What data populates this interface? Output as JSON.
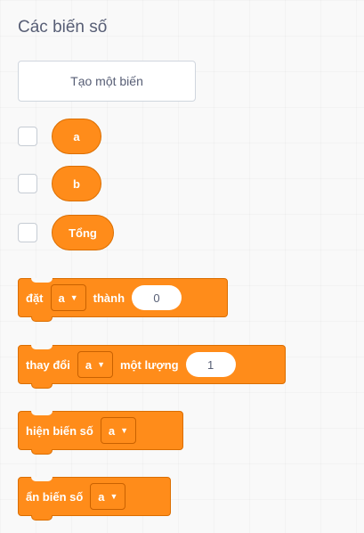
{
  "section": {
    "title": "Các biến số"
  },
  "create_button": {
    "label": "Tạo một biến"
  },
  "variables": [
    {
      "name": "a"
    },
    {
      "name": "b"
    },
    {
      "name": "Tổng"
    }
  ],
  "blocks": {
    "set": {
      "label": "đặt",
      "dropdown": "a",
      "connector": "thành",
      "value": "0"
    },
    "change": {
      "label": "thay đổi",
      "dropdown": "a",
      "connector": "một lượng",
      "value": "1"
    },
    "show": {
      "label": "hiện biến số",
      "dropdown": "a"
    },
    "hide": {
      "label": "ẩn biến số",
      "dropdown": "a"
    }
  },
  "colors": {
    "block": "#ff8c1a",
    "block_border": "#db6e00",
    "text": "#575e75"
  }
}
